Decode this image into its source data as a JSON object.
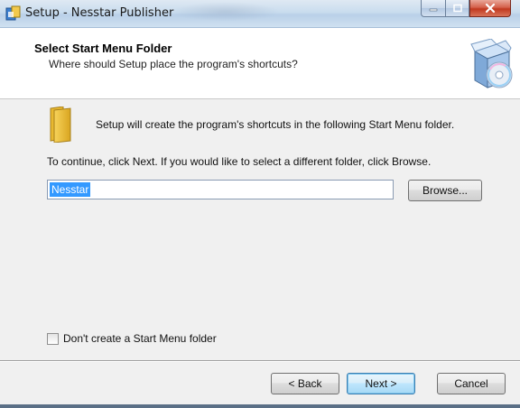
{
  "window": {
    "title": "Setup - Nesstar Publisher"
  },
  "header": {
    "title": "Select Start Menu Folder",
    "subtitle": "Where should Setup place the program's shortcuts?"
  },
  "body": {
    "intro": "Setup will create the program's shortcuts in the following Start Menu folder.",
    "instruction": "To continue, click Next. If you would like to select a different folder, click Browse.",
    "folder_value": "Nesstar",
    "browse_label": "Browse...",
    "checkbox_label": "Don't create a Start Menu folder",
    "checkbox_checked": false
  },
  "footer": {
    "back_label": "< Back",
    "next_label": "Next >",
    "cancel_label": "Cancel"
  },
  "icons": {
    "app": "setup-app-icon",
    "installer": "installer-box-cd-icon",
    "folder": "folder-icon"
  },
  "colors": {
    "selection": "#3399ff",
    "close_button": "#c0391f"
  }
}
